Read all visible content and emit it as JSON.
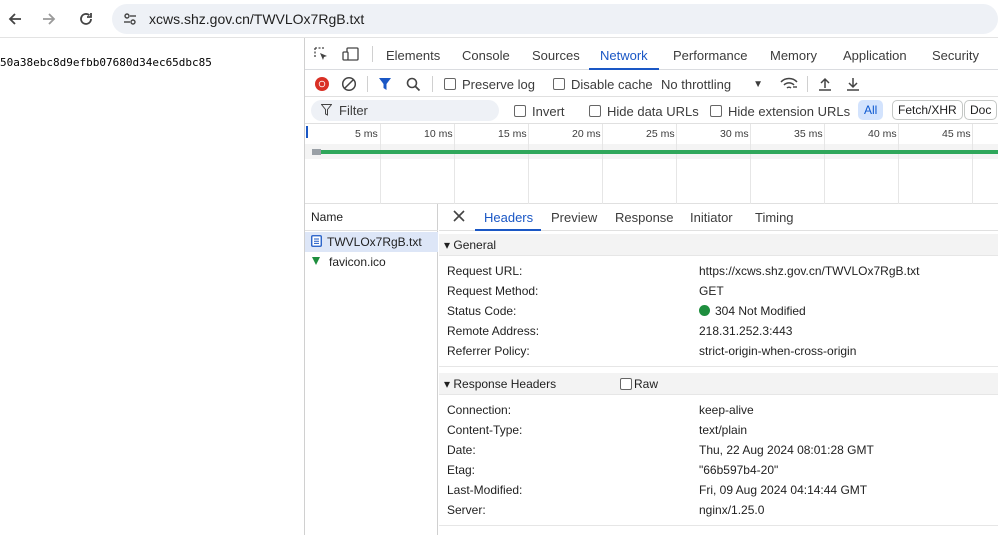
{
  "browser": {
    "url": "xcws.shz.gov.cn/TWVLOx7RgB.txt"
  },
  "page": {
    "content": "50a38ebc8d9efbb07680d34ec65dbc85"
  },
  "devtools": {
    "tabs": [
      "Elements",
      "Console",
      "Sources",
      "Network",
      "Performance",
      "Memory",
      "Application",
      "Security"
    ],
    "active_tab": "Network",
    "toolbar": {
      "preserve_log": "Preserve log",
      "disable_cache": "Disable cache",
      "throttling": "No throttling"
    },
    "filter": {
      "placeholder": "Filter",
      "invert": "Invert",
      "hide_data_urls": "Hide data URLs",
      "hide_extension_urls": "Hide extension URLs",
      "chips": [
        "All",
        "Fetch/XHR",
        "Doc"
      ]
    },
    "timeline": {
      "ticks": [
        "5 ms",
        "10 ms",
        "15 ms",
        "20 ms",
        "25 ms",
        "30 ms",
        "35 ms",
        "40 ms",
        "45 ms"
      ]
    },
    "requests": {
      "header": "Name",
      "items": [
        {
          "name": "TWVLOx7RgB.txt",
          "selected": true
        },
        {
          "name": "favicon.ico",
          "selected": false
        }
      ]
    },
    "detail": {
      "tabs": [
        "Headers",
        "Preview",
        "Response",
        "Initiator",
        "Timing"
      ],
      "active_tab": "Headers",
      "general": {
        "title": "▾ General",
        "rows": [
          {
            "key": "Request URL:",
            "value": "https://xcws.shz.gov.cn/TWVLOx7RgB.txt"
          },
          {
            "key": "Request Method:",
            "value": "GET"
          },
          {
            "key": "Status Code:",
            "value": "304 Not Modified"
          },
          {
            "key": "Remote Address:",
            "value": "218.31.252.3:443"
          },
          {
            "key": "Referrer Policy:",
            "value": "strict-origin-when-cross-origin"
          }
        ]
      },
      "response_headers": {
        "title": "▾ Response Headers",
        "raw_label": "Raw",
        "rows": [
          {
            "key": "Connection:",
            "value": "keep-alive"
          },
          {
            "key": "Content-Type:",
            "value": "text/plain"
          },
          {
            "key": "Date:",
            "value": "Thu, 22 Aug 2024 08:01:28 GMT"
          },
          {
            "key": "Etag:",
            "value": "\"66b597b4-20\""
          },
          {
            "key": "Last-Modified:",
            "value": "Fri, 09 Aug 2024 04:14:44 GMT"
          },
          {
            "key": "Server:",
            "value": "nginx/1.25.0"
          }
        ]
      }
    }
  },
  "colors": {
    "accent": "#1a57c5",
    "status_ok": "#1e8e3e",
    "record": "#d93025",
    "filter_icon": "#1a57c5"
  }
}
